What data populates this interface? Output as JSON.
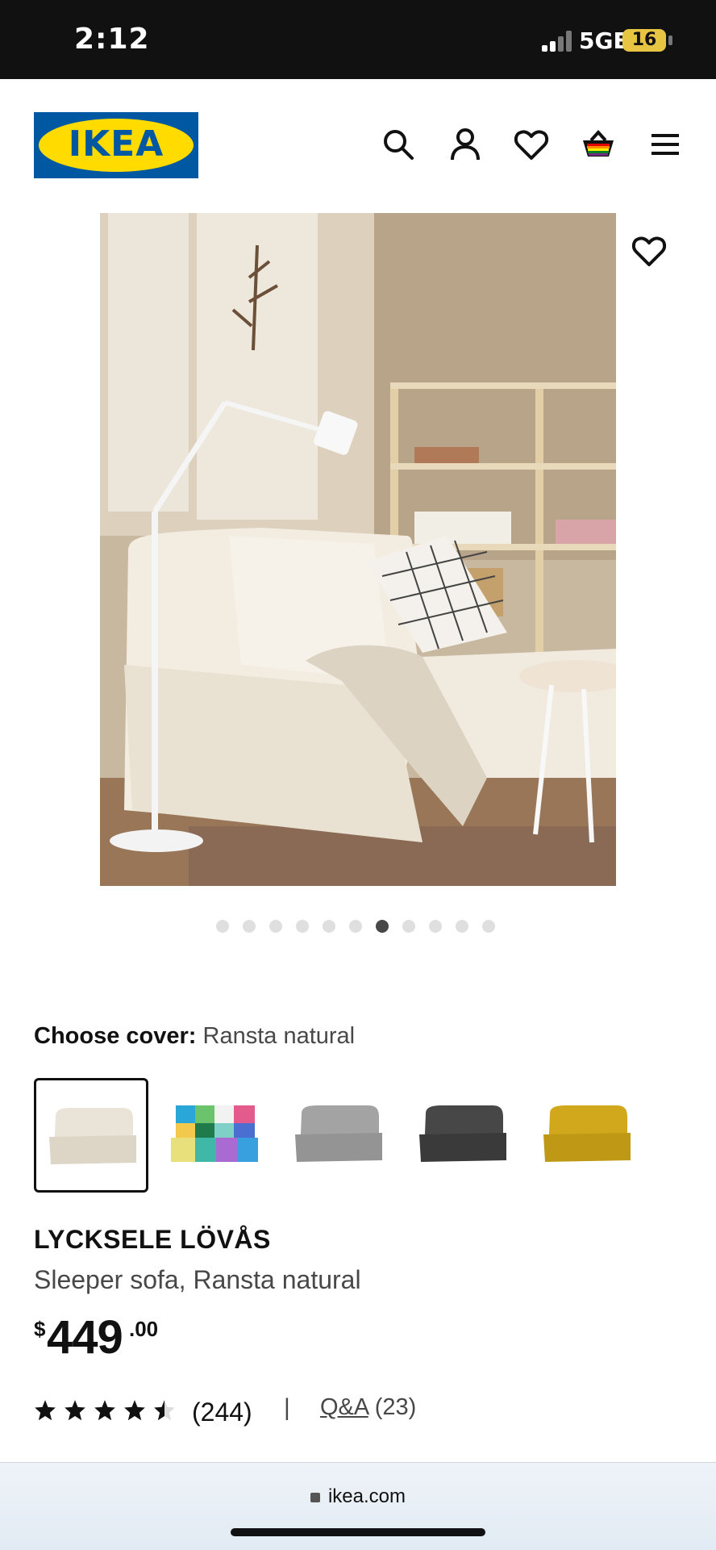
{
  "status_bar": {
    "time": "2:12",
    "network": "5GE",
    "battery": "16"
  },
  "header": {
    "logo_text": "IKEA",
    "icons": [
      "search-icon",
      "profile-icon",
      "wishlist-icon",
      "cart-icon",
      "menu-icon"
    ]
  },
  "gallery": {
    "image_count": 11,
    "active_index": 6,
    "favorite_icon": "heart-icon"
  },
  "cover": {
    "label": "Choose cover:",
    "value": "Ransta natural",
    "options": [
      {
        "color": "#e9e3d8",
        "selected": true
      },
      {
        "color": "multicolor",
        "selected": false
      },
      {
        "color": "#9b9b9b",
        "selected": false
      },
      {
        "color": "#3f3f3f",
        "selected": false
      },
      {
        "color": "#c9a21a",
        "selected": false
      }
    ]
  },
  "product": {
    "name": "LYCKSELE LÖVÅS",
    "description": "Sleeper sofa, Ransta natural",
    "price_currency": "$",
    "price_integer": "449",
    "price_decimal": ".00"
  },
  "rating": {
    "stars": 4.5,
    "count": "(244)",
    "separator": "|",
    "qa_label": "Q&A",
    "qa_count": "(23)"
  },
  "browser": {
    "url": "ikea.com"
  },
  "colors": {
    "ikea_blue": "#0058a3",
    "ikea_yellow": "#ffdb00"
  }
}
